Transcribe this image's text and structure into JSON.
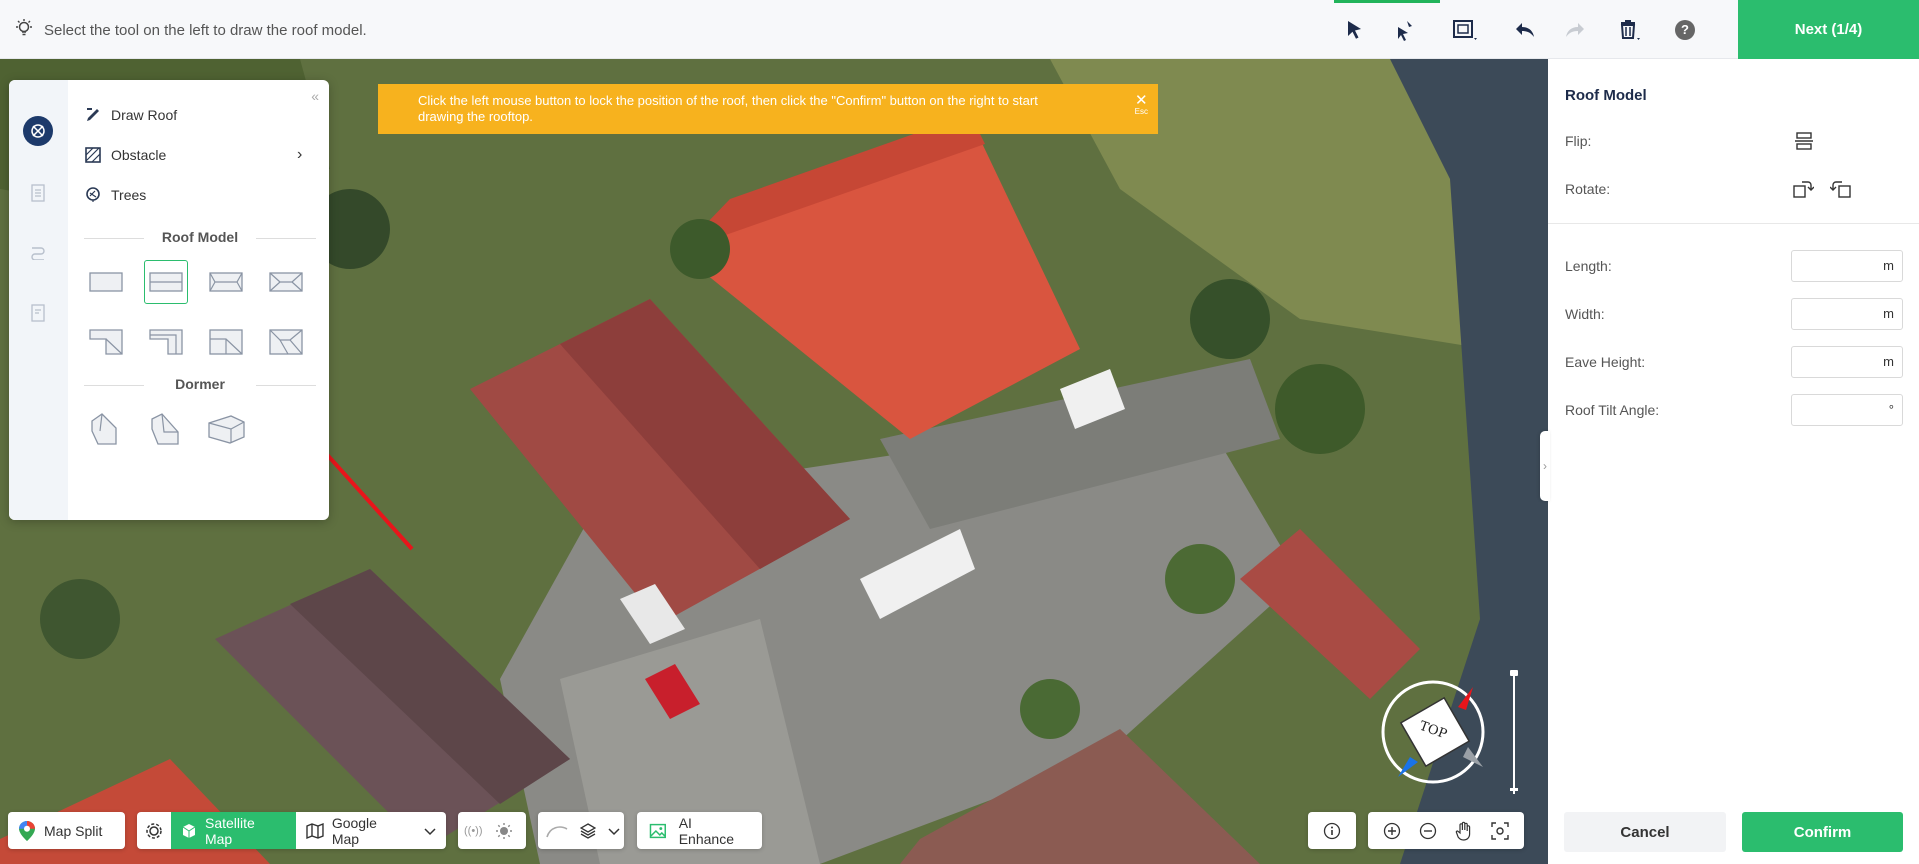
{
  "header": {
    "hint": "Select the tool on the left to draw the roof model.",
    "next_label": "Next (1/4)",
    "help_label": "?"
  },
  "banner": {
    "text": "Click the left mouse button to lock the position of the roof, then click the \"Confirm\" button on the right to start drawing the rooftop.",
    "close_hint": "Esc"
  },
  "toolpanel": {
    "collapse": "«",
    "items": [
      {
        "label": "Draw Roof"
      },
      {
        "label": "Obstacle"
      },
      {
        "label": "Trees"
      }
    ],
    "obstacle_chevron": "›",
    "roof_model_title": "Roof Model",
    "dormer_title": "Dormer"
  },
  "bottom": {
    "map_split": "Map Split",
    "satellite_map": "Satellite Map",
    "google_map": "Google Map",
    "ai_enhance": "AI Enhance",
    "signal_label": "((•))"
  },
  "compass": {
    "label": "TOP"
  },
  "rpanel": {
    "title": "Roof Model",
    "flip_label": "Flip:",
    "rotate_label": "Rotate:",
    "length_label": "Length:",
    "width_label": "Width:",
    "eave_label": "Eave Height:",
    "tilt_label": "Roof Tilt Angle:",
    "length_unit": "m",
    "width_unit": "m",
    "eave_unit": "m",
    "tilt_unit": "°",
    "cancel": "Cancel",
    "confirm": "Confirm",
    "handle": "›"
  },
  "colors": {
    "accent": "#2bbd6e",
    "warning": "#f7b21e",
    "navy": "#1d3a6b"
  }
}
